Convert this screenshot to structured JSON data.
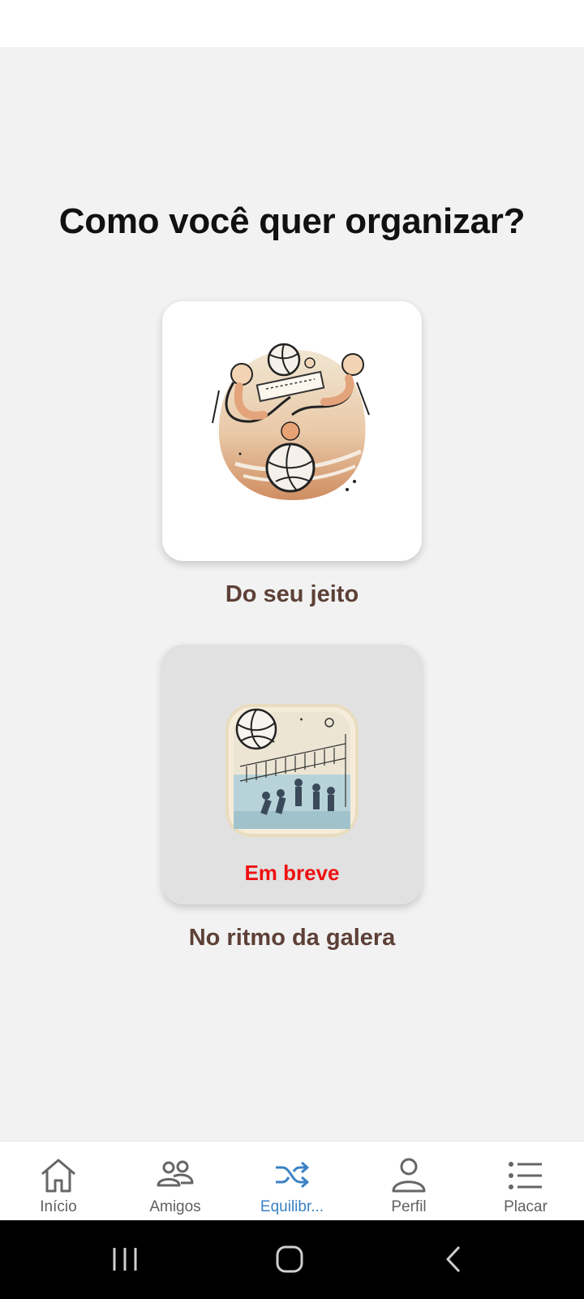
{
  "page": {
    "title": "Como você quer organizar?"
  },
  "options": [
    {
      "label": "Do seu jeito",
      "icon": "volleyball-players-illustration"
    },
    {
      "label": "No ritmo da galera",
      "icon": "volleyball-court-illustration",
      "badge": "Em breve"
    }
  ],
  "nav": {
    "items": [
      {
        "label": "Início",
        "icon": "home-icon"
      },
      {
        "label": "Amigos",
        "icon": "friends-icon"
      },
      {
        "label": "Equilibr...",
        "icon": "shuffle-icon",
        "active": true
      },
      {
        "label": "Perfil",
        "icon": "profile-icon"
      },
      {
        "label": "Placar",
        "icon": "list-icon"
      }
    ]
  },
  "colors": {
    "background": "#f2f2f2",
    "label": "#5d4037",
    "badge": "#ee1111",
    "accent": "#3b82c4"
  }
}
